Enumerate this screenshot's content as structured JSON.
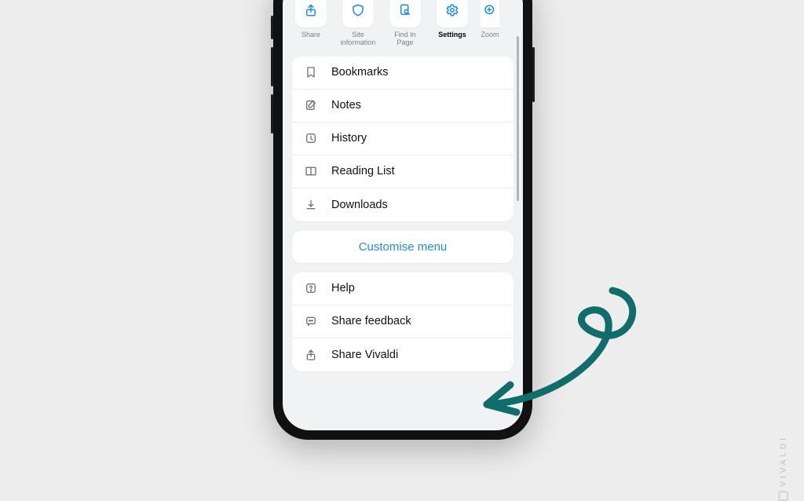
{
  "colors": {
    "accent": "#1a8cff",
    "teal": "#0f6e6b",
    "muted": "#7b7f85"
  },
  "actions": [
    {
      "id": "share",
      "label": "Share",
      "selected": false
    },
    {
      "id": "siteinfo",
      "label": "Site information",
      "selected": false
    },
    {
      "id": "findinpage",
      "label": "Find In Page",
      "selected": false
    },
    {
      "id": "settings",
      "label": "Settings",
      "selected": true
    },
    {
      "id": "zoom",
      "label": "Zoom",
      "selected": false
    }
  ],
  "primary_menu": [
    {
      "id": "bookmarks",
      "label": "Bookmarks"
    },
    {
      "id": "notes",
      "label": "Notes"
    },
    {
      "id": "history",
      "label": "History"
    },
    {
      "id": "readinglist",
      "label": "Reading List"
    },
    {
      "id": "downloads",
      "label": "Downloads"
    }
  ],
  "customise_label": "Customise menu",
  "secondary_menu": [
    {
      "id": "help",
      "label": "Help"
    },
    {
      "id": "feedback",
      "label": "Share feedback"
    },
    {
      "id": "sharevivaldi",
      "label": "Share Vivaldi"
    }
  ],
  "watermark": "VIVALDI"
}
